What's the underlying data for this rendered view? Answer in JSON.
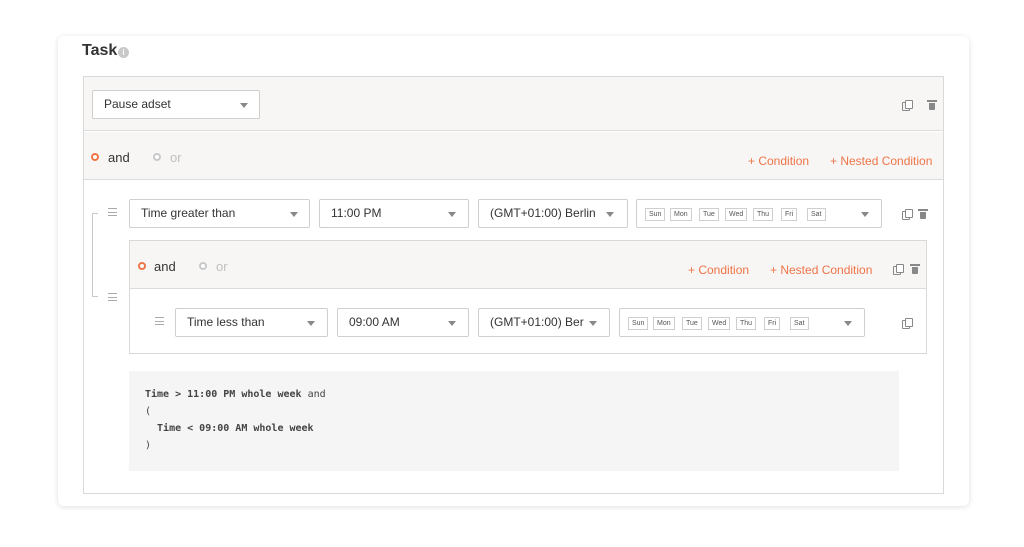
{
  "task": {
    "title": "Task",
    "info_glyph": "i"
  },
  "action": {
    "value": "Pause adset"
  },
  "root_group": {
    "and_label": "and",
    "or_label": "or",
    "active": "and",
    "add_condition": "+ Condition",
    "add_nested": "+ Nested Condition"
  },
  "condition1": {
    "type": "Time greater than",
    "time": "11:00 PM",
    "timezone": "(GMT+01:00) Berlin",
    "days": [
      "Sun",
      "Mon",
      "Tue",
      "Wed",
      "Thu",
      "Fri",
      "Sat"
    ]
  },
  "nested_group": {
    "and_label": "and",
    "or_label": "or",
    "active": "and",
    "add_condition": "+ Condition",
    "add_nested": "+ Nested Condition",
    "condition": {
      "type": "Time less than",
      "time": "09:00 AM",
      "timezone": "(GMT+01:00) Ber",
      "days": [
        "Sun",
        "Mon",
        "Tue",
        "Wed",
        "Thu",
        "Fri",
        "Sat"
      ]
    }
  },
  "summary": {
    "line1_bold": "Time > 11:00 PM whole week",
    "line1_tail": " and",
    "line2": "(",
    "line3": "  Time < 09:00 AM whole week",
    "line4": ")"
  },
  "colors": {
    "accent": "#ee7447",
    "band": "#f7f6f5",
    "code_bg": "#f5f5f5"
  }
}
